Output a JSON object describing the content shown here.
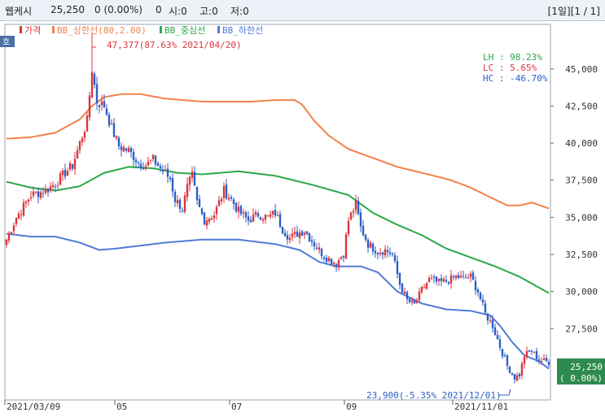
{
  "header": {
    "name": "웹케시",
    "price": "25,250",
    "change": "0 (0.00%)",
    "volume": "0",
    "open_label": "시:0",
    "high_label": "고:0",
    "low_label": "저:0",
    "period_button": "[1일]",
    "page_button": "[1 / 1]"
  },
  "corner_button": "호",
  "legend": [
    {
      "label": "가격",
      "color": "#d9363e"
    },
    {
      "label": "BB_상한선(80,2.00)",
      "color": "#f0824a"
    },
    {
      "label": "BB_중심선",
      "color": "#2aa84a"
    },
    {
      "label": "BB_하한선",
      "color": "#4f7bd9"
    }
  ],
  "stats": [
    {
      "label": "LH :  98.23%",
      "color": "#2aa84a"
    },
    {
      "label": "LC :   5.65%",
      "color": "#d9363e"
    },
    {
      "label": "HC : -46.70%",
      "color": "#2c5fc7"
    }
  ],
  "annotations": {
    "max": "47,377(87.63% 2021/04/20)",
    "min": "23,900(-5.35% 2021/12/01)"
  },
  "price_tag": {
    "value": "25,250",
    "change": "( 0.00%)",
    "color": "#2e8b4e"
  },
  "chart_data": {
    "type": "candlestick",
    "x_labels": [
      "2021/03/09",
      "05",
      "07",
      "09",
      "2021/11/01"
    ],
    "y_ticks": [
      "45,000",
      "42,500",
      "40,000",
      "37,500",
      "35,000",
      "32,500",
      "30,000",
      "27,500"
    ],
    "ylim": [
      22700,
      48000
    ],
    "grid": false,
    "colors": {
      "up": "#d9363e",
      "down": "#2c5fc7",
      "upper": "#f0824a",
      "middle": "#2aa84a",
      "lower": "#4f7bd9"
    },
    "close_anchors": [
      [
        0,
        33500
      ],
      [
        4,
        35000
      ],
      [
        10,
        36500
      ],
      [
        16,
        36800
      ],
      [
        20,
        37300
      ],
      [
        24,
        38000
      ],
      [
        27,
        38500
      ],
      [
        30,
        40000
      ],
      [
        33,
        41500
      ],
      [
        35,
        45000
      ],
      [
        37,
        42800
      ],
      [
        40,
        42500
      ],
      [
        43,
        41000
      ],
      [
        46,
        39800
      ],
      [
        50,
        39500
      ],
      [
        54,
        38700
      ],
      [
        57,
        38500
      ],
      [
        60,
        38900
      ],
      [
        63,
        38300
      ],
      [
        67,
        37600
      ],
      [
        69,
        36200
      ],
      [
        72,
        35600
      ],
      [
        74,
        37000
      ],
      [
        76,
        37800
      ],
      [
        78,
        36000
      ],
      [
        81,
        34800
      ],
      [
        85,
        35200
      ],
      [
        89,
        36800
      ],
      [
        92,
        36200
      ],
      [
        95,
        35400
      ],
      [
        99,
        34800
      ],
      [
        103,
        35200
      ],
      [
        107,
        35000
      ],
      [
        110,
        35300
      ],
      [
        113,
        34200
      ],
      [
        116,
        33600
      ],
      [
        119,
        33900
      ],
      [
        122,
        34100
      ],
      [
        126,
        33200
      ],
      [
        130,
        32400
      ],
      [
        135,
        31900
      ],
      [
        138,
        32600
      ],
      [
        140,
        34800
      ],
      [
        143,
        35900
      ],
      [
        145,
        34300
      ],
      [
        148,
        33200
      ],
      [
        152,
        32700
      ],
      [
        155,
        32800
      ],
      [
        158,
        32500
      ],
      [
        161,
        30500
      ],
      [
        164,
        29400
      ],
      [
        167,
        29100
      ],
      [
        170,
        30100
      ],
      [
        173,
        30800
      ],
      [
        177,
        30600
      ],
      [
        180,
        30700
      ],
      [
        184,
        31000
      ],
      [
        187,
        30900
      ],
      [
        190,
        31000
      ],
      [
        193,
        30000
      ],
      [
        196,
        28500
      ],
      [
        199,
        27700
      ],
      [
        202,
        26300
      ],
      [
        205,
        25000
      ],
      [
        208,
        24200
      ],
      [
        210,
        24400
      ],
      [
        212,
        25700
      ],
      [
        215,
        26000
      ],
      [
        218,
        25400
      ],
      [
        222,
        25250
      ]
    ],
    "upper_band": [
      [
        0,
        40300
      ],
      [
        10,
        40400
      ],
      [
        20,
        40700
      ],
      [
        30,
        41600
      ],
      [
        35,
        42500
      ],
      [
        40,
        43100
      ],
      [
        47,
        43300
      ],
      [
        55,
        43300
      ],
      [
        65,
        43000
      ],
      [
        80,
        42800
      ],
      [
        100,
        42800
      ],
      [
        110,
        42900
      ],
      [
        118,
        42900
      ],
      [
        121,
        42600
      ],
      [
        126,
        41500
      ],
      [
        132,
        40500
      ],
      [
        140,
        39600
      ],
      [
        150,
        39000
      ],
      [
        160,
        38400
      ],
      [
        170,
        38000
      ],
      [
        175,
        37800
      ],
      [
        182,
        37500
      ],
      [
        190,
        37000
      ],
      [
        200,
        36200
      ],
      [
        205,
        35800
      ],
      [
        210,
        35800
      ],
      [
        215,
        36000
      ],
      [
        222,
        35600
      ]
    ],
    "middle_band": [
      [
        0,
        37400
      ],
      [
        10,
        37000
      ],
      [
        20,
        36800
      ],
      [
        30,
        37100
      ],
      [
        40,
        38000
      ],
      [
        50,
        38400
      ],
      [
        60,
        38300
      ],
      [
        70,
        38000
      ],
      [
        80,
        37900
      ],
      [
        95,
        38100
      ],
      [
        110,
        37800
      ],
      [
        125,
        37200
      ],
      [
        140,
        36500
      ],
      [
        150,
        35300
      ],
      [
        160,
        34500
      ],
      [
        170,
        33800
      ],
      [
        180,
        32900
      ],
      [
        190,
        32300
      ],
      [
        200,
        31700
      ],
      [
        210,
        31000
      ],
      [
        222,
        29900
      ]
    ],
    "lower_band": [
      [
        0,
        33900
      ],
      [
        10,
        33700
      ],
      [
        20,
        33700
      ],
      [
        30,
        33300
      ],
      [
        38,
        32800
      ],
      [
        45,
        32900
      ],
      [
        55,
        33100
      ],
      [
        65,
        33300
      ],
      [
        80,
        33500
      ],
      [
        95,
        33500
      ],
      [
        110,
        33200
      ],
      [
        120,
        32800
      ],
      [
        128,
        32000
      ],
      [
        135,
        31700
      ],
      [
        145,
        31700
      ],
      [
        152,
        31300
      ],
      [
        160,
        30000
      ],
      [
        170,
        29200
      ],
      [
        180,
        28800
      ],
      [
        190,
        28700
      ],
      [
        198,
        28400
      ],
      [
        202,
        27700
      ],
      [
        207,
        26600
      ],
      [
        212,
        25700
      ],
      [
        218,
        25300
      ],
      [
        222,
        24800
      ]
    ],
    "spikes": [
      [
        35,
        47377
      ],
      [
        208,
        23900
      ]
    ]
  }
}
